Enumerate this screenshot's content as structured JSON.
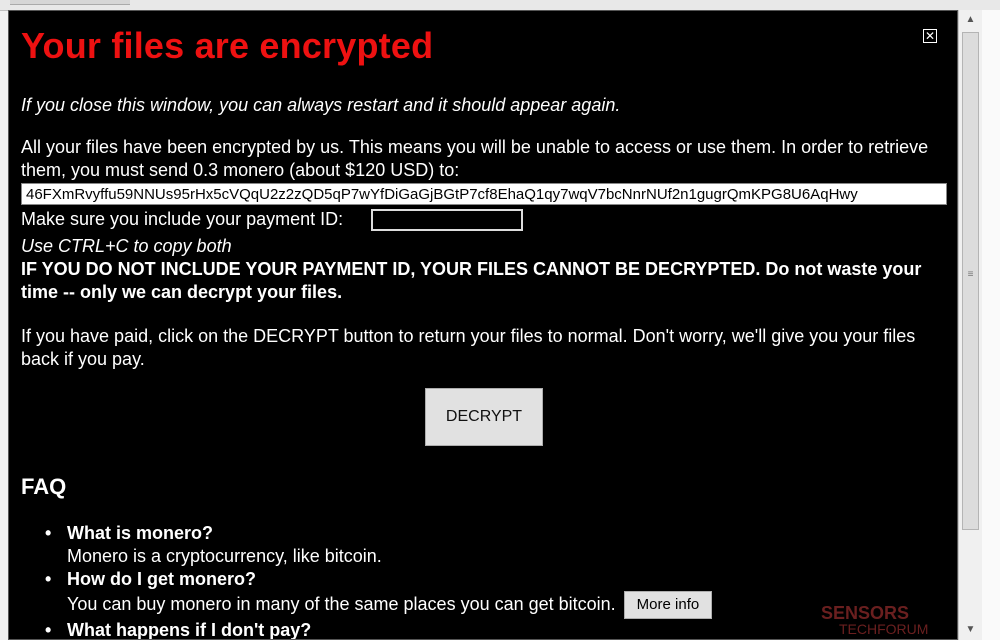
{
  "title": "Your files are encrypted",
  "close_icon": "close-icon",
  "note_italic": "If you close this window, you can always restart and it should appear again.",
  "intro": "All your files have been encrypted by us. This means you will be unable to access or use them. In order to retrieve them, you must send 0.3 monero (about $120 USD) to:",
  "address": "46FXmRvyffu59NNUs95rHx5cVQqU2z2zQD5qP7wYfDiGaGjBGtP7cf8EhaQ1qy7wqV7bcNnrNUf2n1gugrQmKPG8U6AqHwy",
  "payment_id_label": "Make sure you include your payment ID:",
  "payment_id_value": "",
  "copy_hint": "Use CTRL+C to copy both",
  "warning": "IF YOU DO NOT INCLUDE YOUR PAYMENT ID, YOUR FILES CANNOT BE DECRYPTED. Do not waste your time -- only we can decrypt your files.",
  "paid_text": "If you have paid, click on the DECRYPT button to return your files to normal. Don't worry, we'll give you your files back if you pay.",
  "decrypt_label": "DECRYPT",
  "faq_heading": "FAQ",
  "faq": [
    {
      "q": "What is monero?",
      "a": "Monero is a cryptocurrency, like bitcoin."
    },
    {
      "q": "How do I get monero?",
      "a": "You can buy monero in many of the same places you can get bitcoin.",
      "button": "More info"
    },
    {
      "q": "What happens if I don't pay?",
      "a": ""
    }
  ],
  "watermark": {
    "line1": "SENSORS",
    "line2": "TECHFORUM"
  },
  "colors": {
    "background": "#000000",
    "title": "#ee1111",
    "text": "#ffffff"
  }
}
